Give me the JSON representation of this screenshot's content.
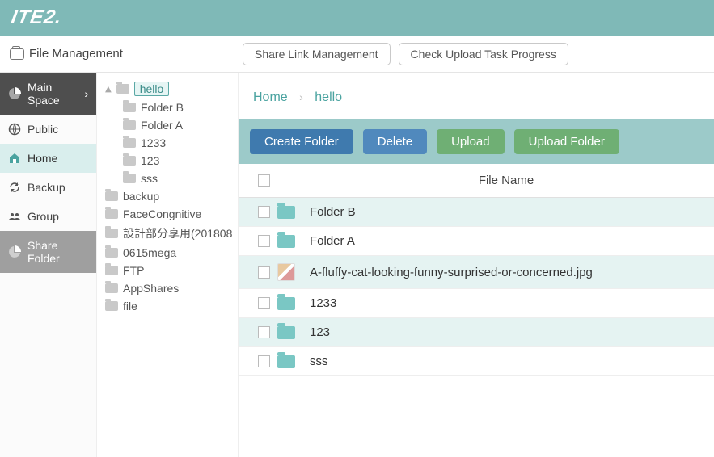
{
  "brand": "ITE2.",
  "header": {
    "file_management": "File Management",
    "share_link_btn": "Share Link Management",
    "check_upload_btn": "Check Upload Task Progress"
  },
  "nav": {
    "main_space": "Main Space",
    "public": "Public",
    "home": "Home",
    "backup": "Backup",
    "group": "Group",
    "share_folder": "Share Folder"
  },
  "tree": {
    "root": "hello",
    "children": [
      "Folder B",
      "Folder A",
      "1233",
      "123",
      "sss"
    ],
    "siblings": [
      "backup",
      "FaceCongnitive",
      "設計部分享用(201808",
      "0615mega",
      "FTP",
      "AppShares",
      "file"
    ]
  },
  "breadcrumb": {
    "home": "Home",
    "current": "hello"
  },
  "actions": {
    "create_folder": "Create Folder",
    "delete": "Delete",
    "upload": "Upload",
    "upload_folder": "Upload Folder"
  },
  "table": {
    "col_filename": "File Name",
    "rows": [
      {
        "type": "folder",
        "name": "Folder B"
      },
      {
        "type": "folder",
        "name": "Folder A"
      },
      {
        "type": "image",
        "name": "A-fluffy-cat-looking-funny-surprised-or-concerned.jpg"
      },
      {
        "type": "folder",
        "name": "1233"
      },
      {
        "type": "folder",
        "name": "123"
      },
      {
        "type": "folder",
        "name": "sss"
      }
    ]
  }
}
